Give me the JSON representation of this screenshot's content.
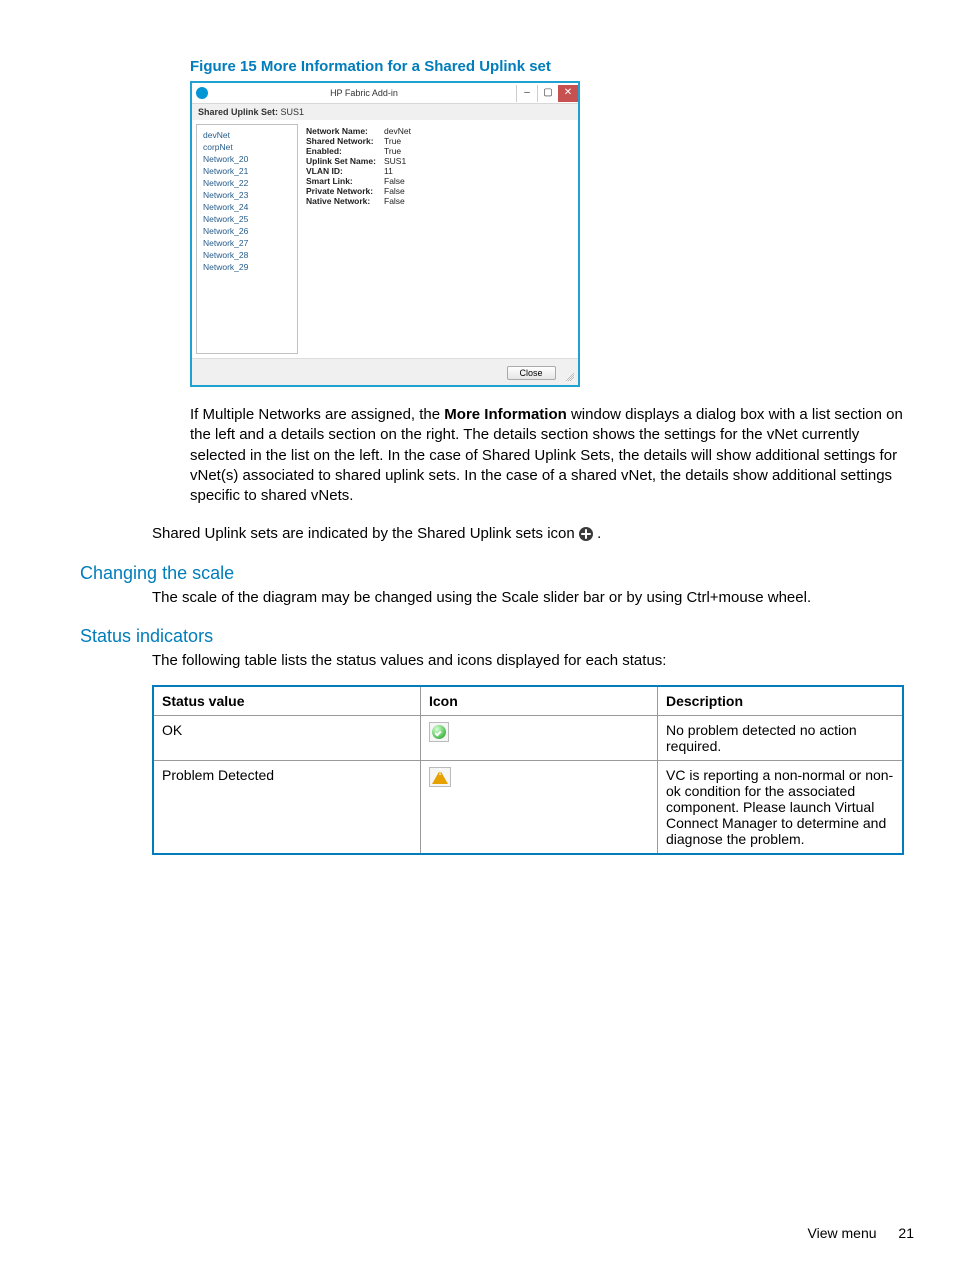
{
  "figure": {
    "caption": "Figure 15 More Information for a Shared Uplink set"
  },
  "dialog": {
    "windowTitle": "HP Fabric Add-in",
    "headerLabel": "Shared Uplink Set:",
    "headerValue": "SUS1",
    "closeLabel": "Close",
    "list": [
      "devNet",
      "corpNet",
      "Network_20",
      "Network_21",
      "Network_22",
      "Network_23",
      "Network_24",
      "Network_25",
      "Network_26",
      "Network_27",
      "Network_28",
      "Network_29"
    ],
    "details": [
      {
        "label": "Network Name:",
        "value": "devNet"
      },
      {
        "label": "Shared Network:",
        "value": "True"
      },
      {
        "label": "Enabled:",
        "value": "True"
      },
      {
        "label": "Uplink Set Name:",
        "value": "SUS1"
      },
      {
        "label": "VLAN ID:",
        "value": "11"
      },
      {
        "label": "Smart Link:",
        "value": "False"
      },
      {
        "label": "Private Network:",
        "value": "False"
      },
      {
        "label": "Native Network:",
        "value": "False"
      }
    ]
  },
  "paragraphs": {
    "p1a": "If Multiple Networks are assigned, the ",
    "p1b": "More Information",
    "p1c": " window displays a dialog box with a list section on the left and a details section on the right. The details section shows the settings for the vNet currently selected in the list on the left. In the case of Shared Uplink Sets, the details will show additional settings for vNet(s) associated to shared uplink sets. In the case of a shared vNet, the details show additional settings specific to shared vNets.",
    "p2": "Shared Uplink sets are indicated by the Shared Uplink sets icon ",
    "p2end": ".",
    "scaleHeading": "Changing the scale",
    "scaleBody": "The scale of the diagram may be changed using the Scale slider bar or by using Ctrl+mouse wheel.",
    "statusHeading": "Status indicators",
    "statusIntro": "The following table lists the status values and icons displayed for each status:"
  },
  "table": {
    "headers": [
      "Status value",
      "Icon",
      "Description"
    ],
    "rows": [
      {
        "status": "OK",
        "icon": "ok",
        "desc": "No problem detected no action required."
      },
      {
        "status": "Problem Detected",
        "icon": "warn",
        "desc": "VC is reporting a non-normal or non-ok condition for the associated component. Please launch Virtual Connect Manager to determine and diagnose the problem."
      }
    ]
  },
  "footer": {
    "section": "View menu",
    "page": "21"
  }
}
